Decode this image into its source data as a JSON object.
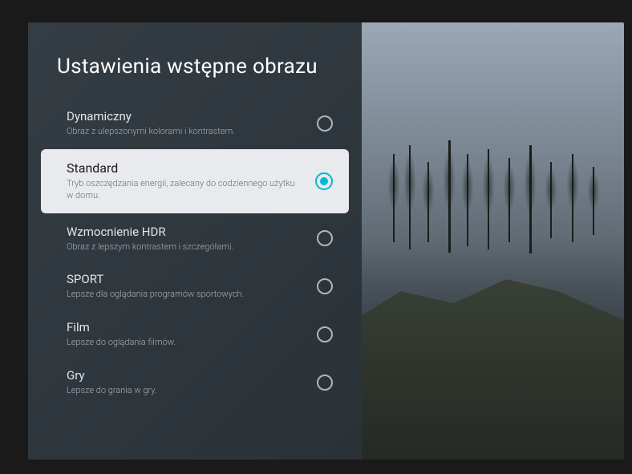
{
  "page_title": "Ustawienia wstępne obrazu",
  "options": [
    {
      "label": "Dynamiczny",
      "description": "Obraz z ulepszonymi kolorami i kontrastem.",
      "selected": false
    },
    {
      "label": "Standard",
      "description": "Tryb oszczędzania energii, zalecany do codziennego użytku w domu.",
      "selected": true
    },
    {
      "label": "Wzmocnienie HDR",
      "description": "Obraz z lepszym kontrastem i szczegółami.",
      "selected": false
    },
    {
      "label": "SPORT",
      "description": "Lepsze dla oglądania programów sportowych.",
      "selected": false
    },
    {
      "label": "Film",
      "description": "Lepsze do oglądania filmów.",
      "selected": false
    },
    {
      "label": "Gry",
      "description": "Lepsze do grania w gry.",
      "selected": false
    }
  ],
  "accent_color": "#00b8d4"
}
